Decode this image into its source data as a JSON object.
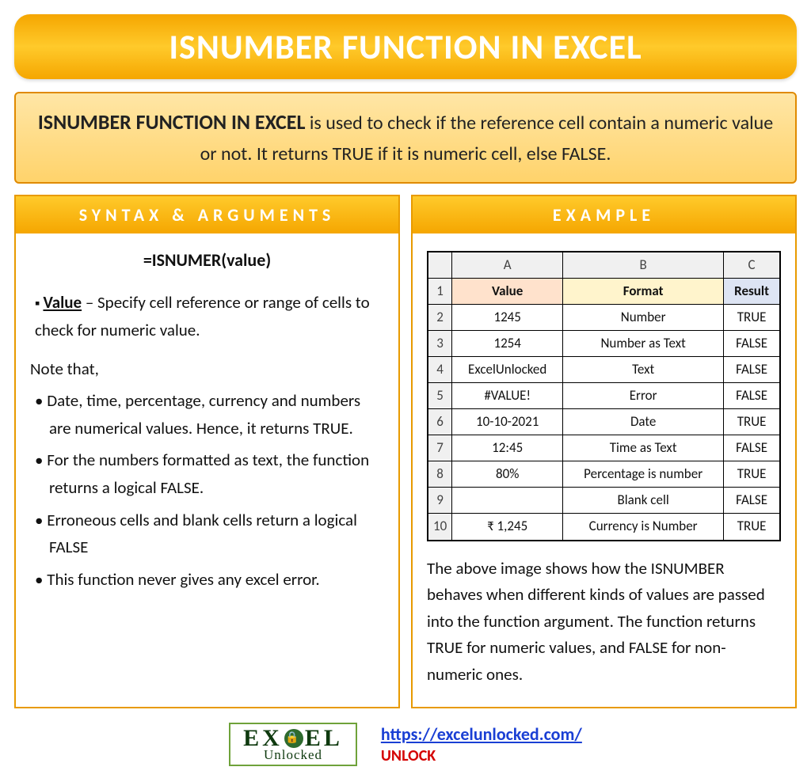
{
  "title": "ISNUMBER FUNCTION IN EXCEL",
  "description": {
    "bold": "ISNUMBER FUNCTION IN EXCEL",
    "rest": " is used to check if the reference cell contain a numeric value or not. It returns TRUE if it is numeric cell, else FALSE."
  },
  "left": {
    "header": "SYNTAX & ARGUMENTS",
    "syntax": "=ISNUMER(value)",
    "arg_name": "Value",
    "arg_desc": " – Specify cell reference or range of cells to check for numeric value.",
    "note_label": "Note that,",
    "notes": [
      "Date, time, percentage, currency and numbers are numerical values. Hence, it returns TRUE.",
      "For the numbers formatted as text, the function returns a logical FALSE.",
      "Erroneous cells and blank cells return a logical FALSE",
      "This function never gives any excel error."
    ]
  },
  "right": {
    "header": "EXAMPLE",
    "col_letters": [
      "A",
      "B",
      "C"
    ],
    "header_row": [
      "Value",
      "Format",
      "Result"
    ],
    "rows": [
      {
        "n": "2",
        "a": "1245",
        "b": "Number",
        "c": "TRUE"
      },
      {
        "n": "3",
        "a": "1254",
        "b": "Number as Text",
        "c": "FALSE"
      },
      {
        "n": "4",
        "a": "ExcelUnlocked",
        "b": "Text",
        "c": "FALSE"
      },
      {
        "n": "5",
        "a": "#VALUE!",
        "b": "Error",
        "c": "FALSE"
      },
      {
        "n": "6",
        "a": "10-10-2021",
        "b": "Date",
        "c": "TRUE"
      },
      {
        "n": "7",
        "a": "12:45",
        "b": "Time as Text",
        "c": "FALSE"
      },
      {
        "n": "8",
        "a": "80%",
        "b": "Percentage is number",
        "c": "TRUE"
      },
      {
        "n": "9",
        "a": "",
        "b": "Blank cell",
        "c": "FALSE"
      },
      {
        "n": "10",
        "a": "₹ 1,245",
        "b": "Currency is Number",
        "c": "TRUE"
      }
    ],
    "caption": "The above image shows how the ISNUMBER behaves when different kinds of values are passed into the function argument. The function returns TRUE for numeric values, and FALSE for non-numeric ones."
  },
  "footer": {
    "logo_top_left": "EX",
    "logo_top_right": "EL",
    "logo_sub": "Unlocked",
    "url": "https://excelunlocked.com/",
    "unlock": "UNLOCK"
  }
}
